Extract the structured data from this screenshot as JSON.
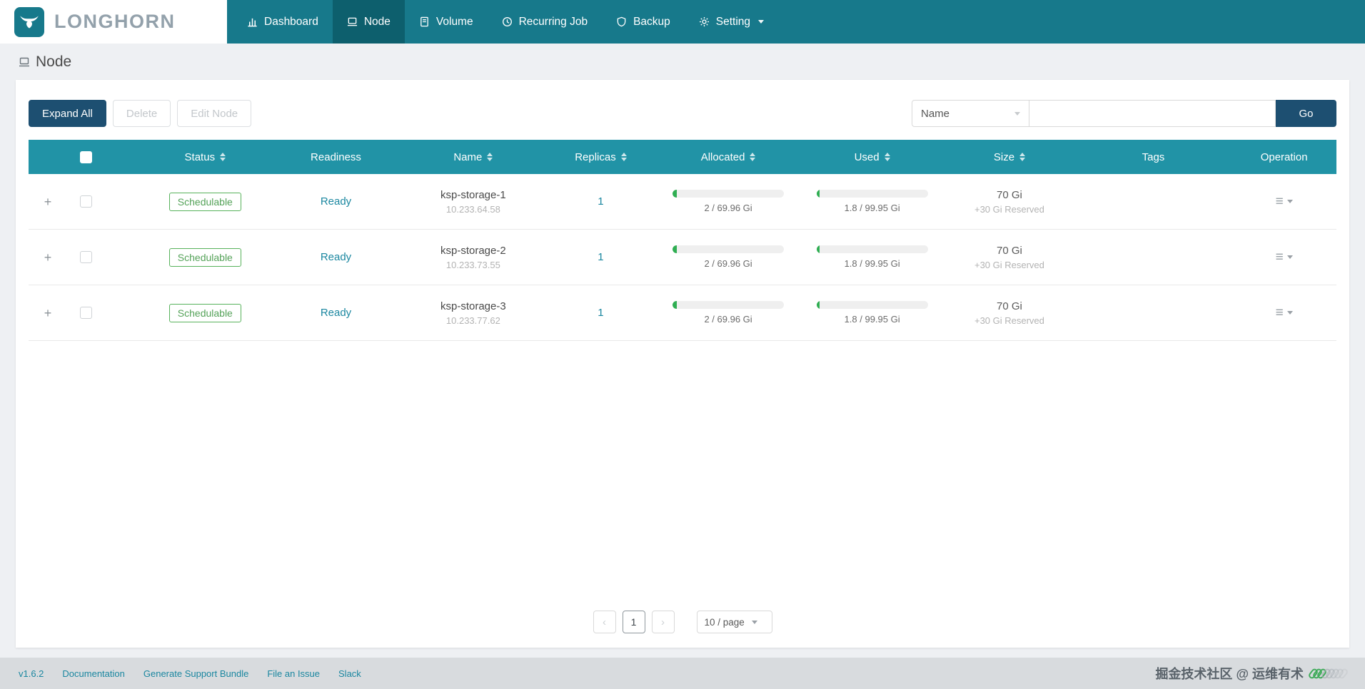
{
  "brand": {
    "name": "LONGHORN"
  },
  "nav": {
    "items": [
      {
        "label": "Dashboard",
        "icon": "dashboard-icon",
        "active": false
      },
      {
        "label": "Node",
        "icon": "node-icon",
        "active": true
      },
      {
        "label": "Volume",
        "icon": "volume-icon",
        "active": false
      },
      {
        "label": "Recurring Job",
        "icon": "recurring-job-icon",
        "active": false
      },
      {
        "label": "Backup",
        "icon": "backup-icon",
        "active": false
      },
      {
        "label": "Setting",
        "icon": "setting-icon",
        "active": false,
        "has_dropdown": true
      }
    ]
  },
  "page": {
    "title": "Node"
  },
  "toolbar": {
    "expand_all_label": "Expand All",
    "delete_label": "Delete",
    "edit_node_label": "Edit Node",
    "filter_field_value": "Name",
    "search_value": "",
    "search_placeholder": "",
    "go_label": "Go"
  },
  "table": {
    "columns": [
      {
        "label": "Status",
        "sortable": true
      },
      {
        "label": "Readiness",
        "sortable": false
      },
      {
        "label": "Name",
        "sortable": true
      },
      {
        "label": "Replicas",
        "sortable": true
      },
      {
        "label": "Allocated",
        "sortable": true
      },
      {
        "label": "Used",
        "sortable": true
      },
      {
        "label": "Size",
        "sortable": true
      },
      {
        "label": "Tags",
        "sortable": false
      },
      {
        "label": "Operation",
        "sortable": false
      }
    ],
    "rows": [
      {
        "status": "Schedulable",
        "readiness": "Ready",
        "name": "ksp-storage-1",
        "ip": "10.233.64.58",
        "replicas": "1",
        "allocated": {
          "label": "2 / 69.96 Gi",
          "percent": 4
        },
        "used": {
          "label": "1.8 / 99.95 Gi",
          "percent": 3
        },
        "size": "70 Gi",
        "size_note": "+30 Gi Reserved",
        "tags": ""
      },
      {
        "status": "Schedulable",
        "readiness": "Ready",
        "name": "ksp-storage-2",
        "ip": "10.233.73.55",
        "replicas": "1",
        "allocated": {
          "label": "2 / 69.96 Gi",
          "percent": 4
        },
        "used": {
          "label": "1.8 / 99.95 Gi",
          "percent": 3
        },
        "size": "70 Gi",
        "size_note": "+30 Gi Reserved",
        "tags": ""
      },
      {
        "status": "Schedulable",
        "readiness": "Ready",
        "name": "ksp-storage-3",
        "ip": "10.233.77.62",
        "replicas": "1",
        "allocated": {
          "label": "2 / 69.96 Gi",
          "percent": 4
        },
        "used": {
          "label": "1.8 / 99.95 Gi",
          "percent": 3
        },
        "size": "70 Gi",
        "size_note": "+30 Gi Reserved",
        "tags": ""
      }
    ]
  },
  "pagination": {
    "prev": "‹",
    "current": "1",
    "next": "›",
    "page_size": "10 / page"
  },
  "footer": {
    "version": "v1.6.2",
    "links": [
      "Documentation",
      "Generate Support Bundle",
      "File an Issue",
      "Slack"
    ],
    "watermark": "掘金技术社区 @ 运维有术"
  },
  "icons": {
    "expand_row": "+",
    "operation_menu": "≡"
  },
  "colors": {
    "navbar": "#17798b",
    "nav_active": "#0d5f6d",
    "table_header": "#2193a6",
    "primary_button": "#1d4f71",
    "link": "#1b87a0",
    "success": "#57b25b",
    "footer_bg": "#d8dbde"
  }
}
